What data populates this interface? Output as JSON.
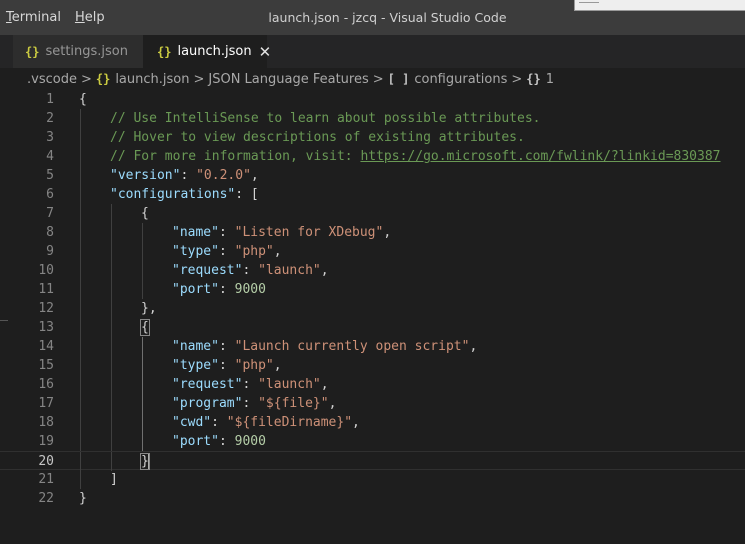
{
  "menu": [
    {
      "mnemonic": "T",
      "rest": "erminal"
    },
    {
      "mnemonic": "H",
      "rest": "elp"
    }
  ],
  "window_title": "launch.json - jzcq - Visual Studio Code",
  "tabs": [
    {
      "icon": "{}",
      "label": "settings.json",
      "active": false
    },
    {
      "icon": "{}",
      "label": "launch.json",
      "active": true,
      "close": "✕"
    }
  ],
  "breadcrumb": {
    "folder": ".vscode",
    "file_icon": "{}",
    "file": "launch.json",
    "provider": "JSON Language Features",
    "array_icon": "[ ]",
    "array": "configurations",
    "object_icon": "{}",
    "object": "1",
    "separator": ">"
  },
  "editor": {
    "current_line": 20,
    "lines": [
      {
        "n": "1",
        "tokens": [
          [
            "pun",
            "{"
          ]
        ]
      },
      {
        "n": "2",
        "tokens": [
          [
            "cmt",
            "// Use IntelliSense to learn about possible attributes."
          ]
        ]
      },
      {
        "n": "3",
        "tokens": [
          [
            "cmt",
            "// Hover to view descriptions of existing attributes."
          ]
        ]
      },
      {
        "n": "4",
        "tokens": [
          [
            "cmt",
            "// For more information, visit: "
          ],
          [
            "lnk",
            "https://go.microsoft.com/fwlink/?linkid=830387"
          ]
        ]
      },
      {
        "n": "5",
        "tokens": [
          [
            "key",
            "\"version\""
          ],
          [
            "pun",
            ": "
          ],
          [
            "str",
            "\"0.2.0\""
          ],
          [
            "pun",
            ","
          ]
        ]
      },
      {
        "n": "6",
        "tokens": [
          [
            "key",
            "\"configurations\""
          ],
          [
            "pun",
            ": ["
          ]
        ]
      },
      {
        "n": "7",
        "tokens": [
          [
            "pun",
            "{"
          ]
        ]
      },
      {
        "n": "8",
        "tokens": [
          [
            "key",
            "\"name\""
          ],
          [
            "pun",
            ": "
          ],
          [
            "str",
            "\"Listen for XDebug\""
          ],
          [
            "pun",
            ","
          ]
        ]
      },
      {
        "n": "9",
        "tokens": [
          [
            "key",
            "\"type\""
          ],
          [
            "pun",
            ": "
          ],
          [
            "str",
            "\"php\""
          ],
          [
            "pun",
            ","
          ]
        ]
      },
      {
        "n": "10",
        "tokens": [
          [
            "key",
            "\"request\""
          ],
          [
            "pun",
            ": "
          ],
          [
            "str",
            "\"launch\""
          ],
          [
            "pun",
            ","
          ]
        ]
      },
      {
        "n": "11",
        "tokens": [
          [
            "key",
            "\"port\""
          ],
          [
            "pun",
            ": "
          ],
          [
            "num",
            "9000"
          ]
        ]
      },
      {
        "n": "12",
        "tokens": [
          [
            "pun",
            "},"
          ]
        ]
      },
      {
        "n": "13",
        "tokens": [
          [
            "pun",
            "{"
          ]
        ]
      },
      {
        "n": "14",
        "tokens": [
          [
            "key",
            "\"name\""
          ],
          [
            "pun",
            ": "
          ],
          [
            "str",
            "\"Launch currently open script\""
          ],
          [
            "pun",
            ","
          ]
        ]
      },
      {
        "n": "15",
        "tokens": [
          [
            "key",
            "\"type\""
          ],
          [
            "pun",
            ": "
          ],
          [
            "str",
            "\"php\""
          ],
          [
            "pun",
            ","
          ]
        ]
      },
      {
        "n": "16",
        "tokens": [
          [
            "key",
            "\"request\""
          ],
          [
            "pun",
            ": "
          ],
          [
            "str",
            "\"launch\""
          ],
          [
            "pun",
            ","
          ]
        ]
      },
      {
        "n": "17",
        "tokens": [
          [
            "key",
            "\"program\""
          ],
          [
            "pun",
            ": "
          ],
          [
            "str",
            "\"${file}\""
          ],
          [
            "pun",
            ","
          ]
        ]
      },
      {
        "n": "18",
        "tokens": [
          [
            "key",
            "\"cwd\""
          ],
          [
            "pun",
            ": "
          ],
          [
            "str",
            "\"${fileDirname}\""
          ],
          [
            "pun",
            ","
          ]
        ]
      },
      {
        "n": "19",
        "tokens": [
          [
            "key",
            "\"port\""
          ],
          [
            "pun",
            ": "
          ],
          [
            "num",
            "9000"
          ]
        ]
      },
      {
        "n": "20",
        "tokens": [
          [
            "pun",
            "}"
          ]
        ]
      },
      {
        "n": "21",
        "tokens": [
          [
            "pun",
            "]"
          ]
        ]
      },
      {
        "n": "22",
        "tokens": [
          [
            "pun",
            "}"
          ]
        ]
      }
    ]
  },
  "colors": {
    "comment": "#6a9955",
    "key": "#9cdcfe",
    "string": "#ce9178",
    "number": "#b5cea8",
    "json_icon": "#cbcb41"
  }
}
